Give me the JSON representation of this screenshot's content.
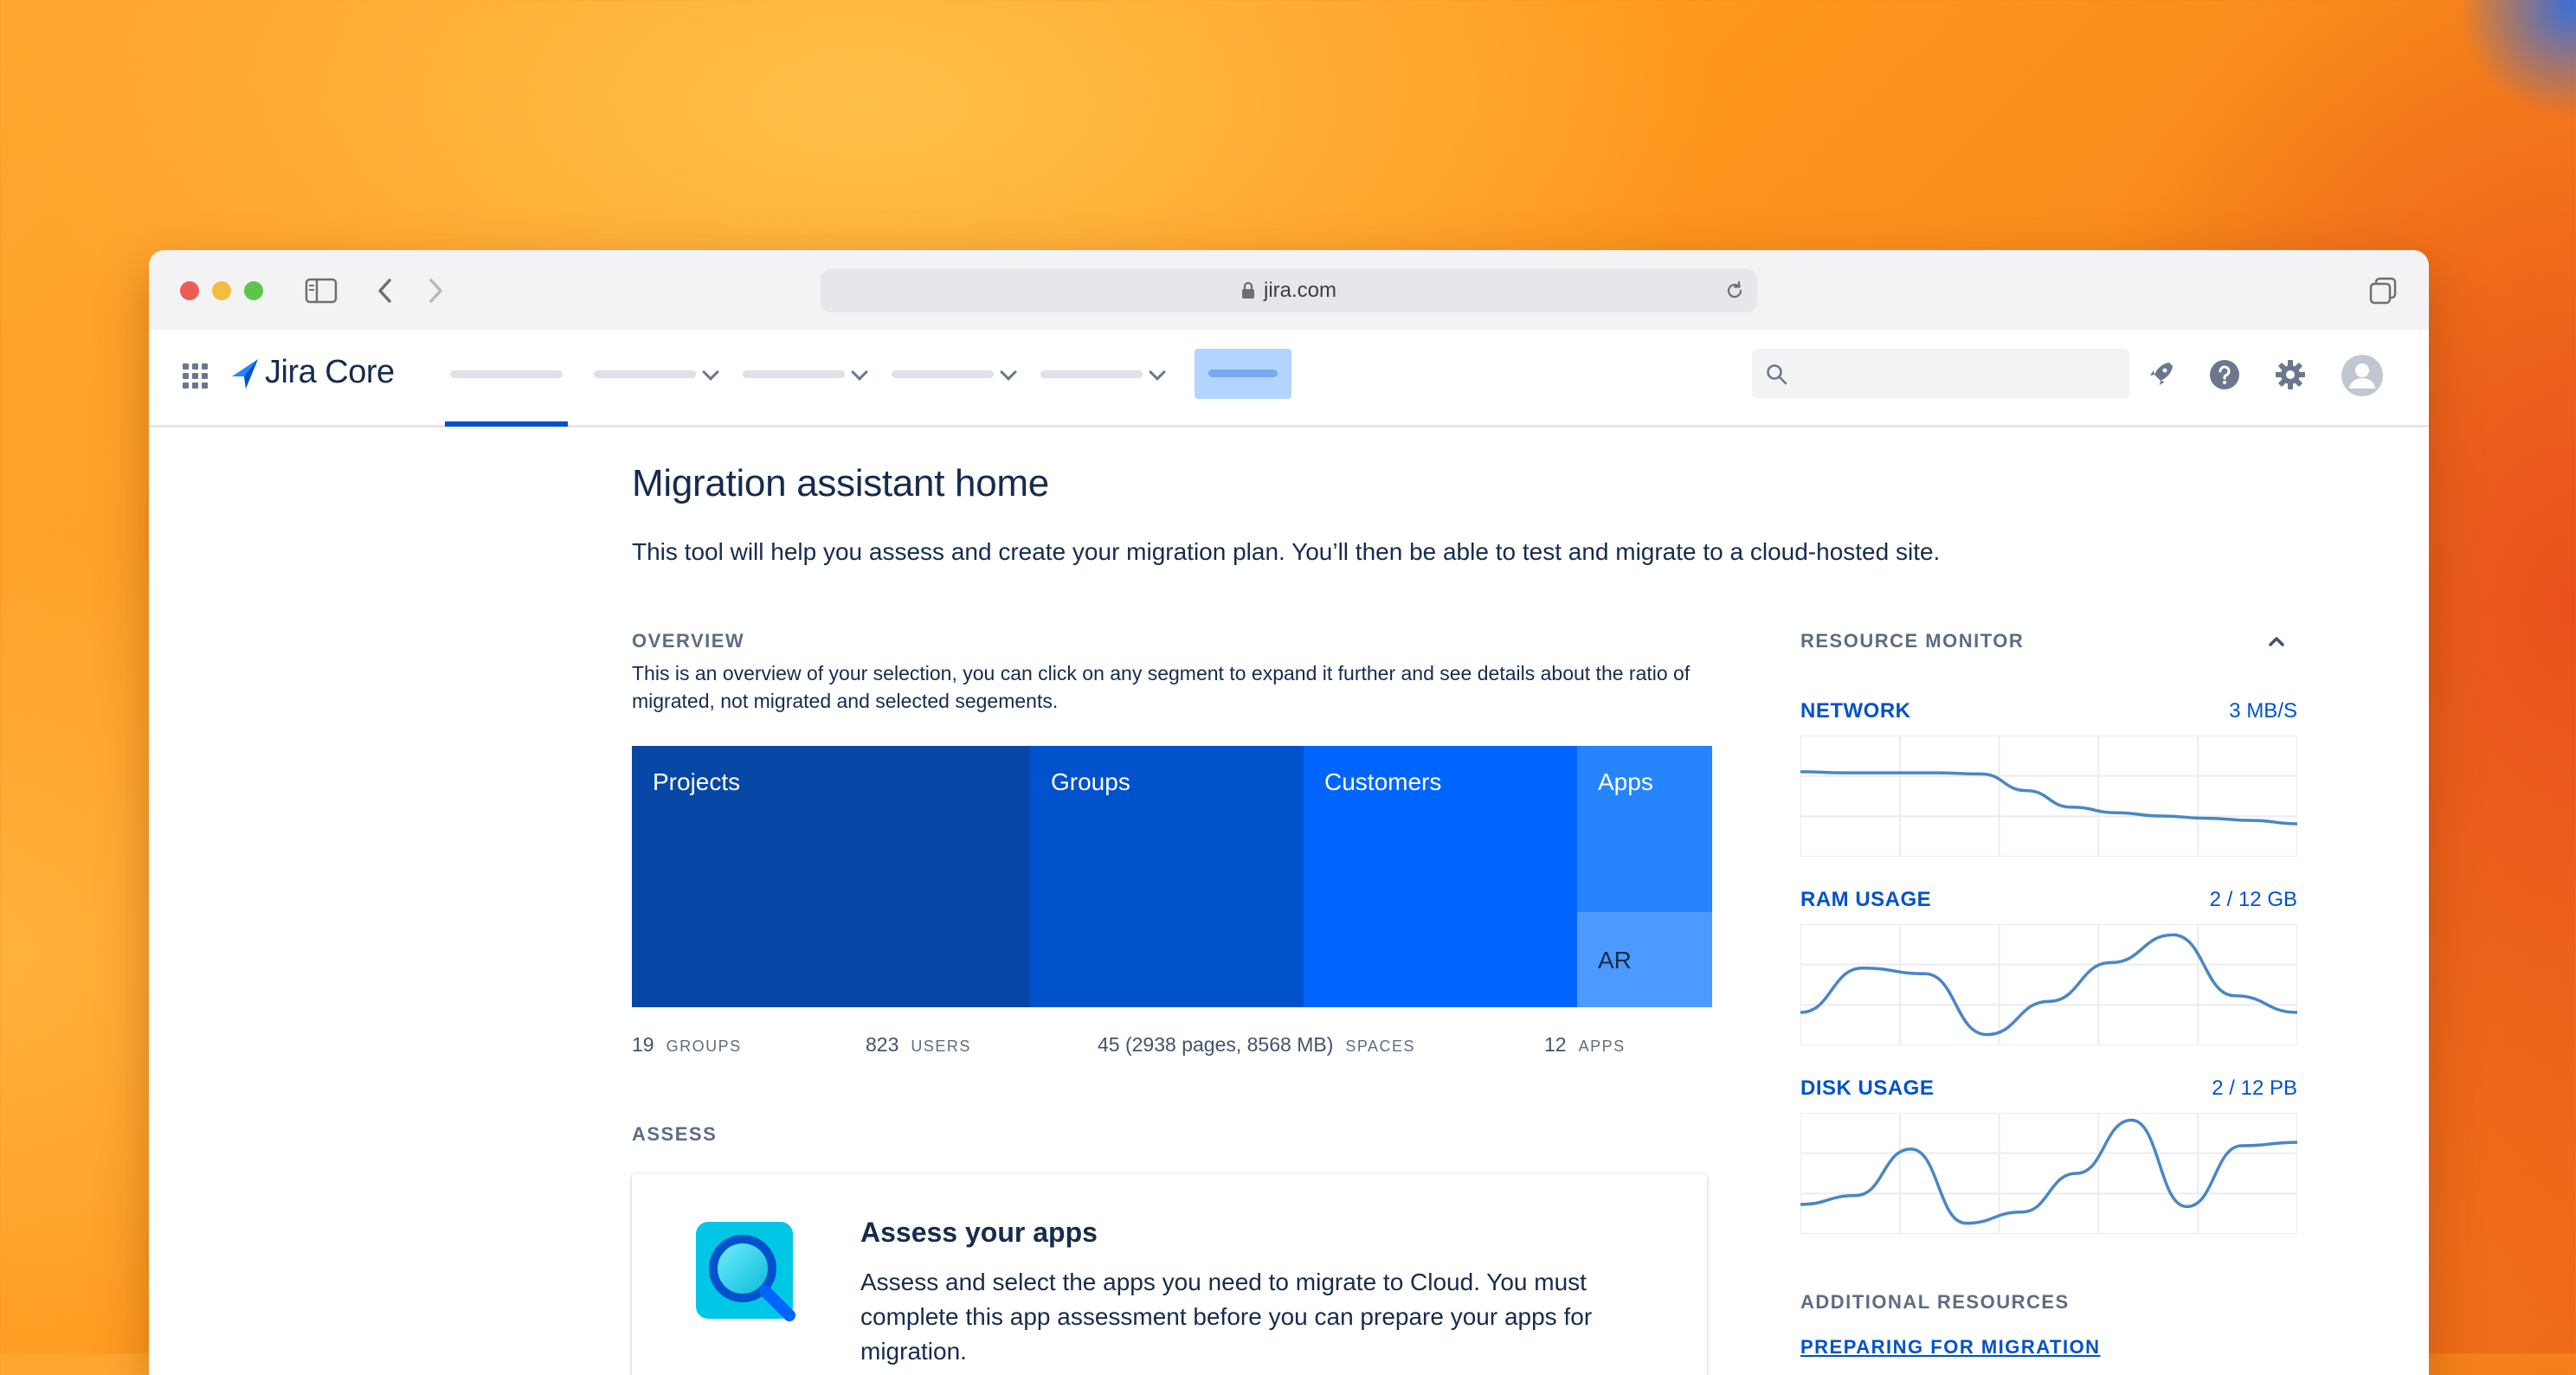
{
  "browser": {
    "url": "jira.com",
    "traffic_lights": [
      "#ee5c55",
      "#f5bd3e",
      "#5ec54b"
    ]
  },
  "app": {
    "name": "Jira Core",
    "brand_color": "#2684ff"
  },
  "page": {
    "title": "Migration assistant home",
    "intro": "This tool will help you assess and create your migration plan. You’ll then be able to test and migrate to a cloud-hosted site."
  },
  "overview": {
    "label": "OVERVIEW",
    "description": "This is an overview of your selection, you can click on any segment to expand it further and see details about the ratio of migrated, not migrated and selected segements.",
    "segments": [
      {
        "label": "Projects",
        "color": "#0747a6"
      },
      {
        "label": "Groups",
        "color": "#0052cc"
      },
      {
        "label": "Customers",
        "color": "#0065ff"
      },
      {
        "label": "Apps",
        "color": "#2684ff"
      },
      {
        "label": "AR",
        "color": "#4c9aff"
      }
    ],
    "stats": [
      {
        "value": "19",
        "caption": "GROUPS"
      },
      {
        "value": "823",
        "caption": "USERS"
      },
      {
        "value": "45 (2938 pages, 8568 MB)",
        "caption": "SPACES"
      },
      {
        "value": "12",
        "caption": "APPS"
      }
    ]
  },
  "assess": {
    "label": "ASSESS",
    "card_title": "Assess your apps",
    "card_description": "Assess and select the apps you need to migrate to Cloud. You must complete this app assessment before you can prepare your apps for migration."
  },
  "resource_monitor": {
    "label": "RESOURCE MONITOR",
    "line_color": "#4a86c5",
    "items": [
      {
        "name": "NETWORK",
        "value": "3 MB/S",
        "series": [
          0.72,
          0.71,
          0.71,
          0.71,
          0.7,
          0.55,
          0.4,
          0.35,
          0.32,
          0.3,
          0.28,
          0.25
        ]
      },
      {
        "name": "RAM USAGE",
        "value": "2 / 12 GB",
        "series": [
          0.25,
          0.65,
          0.6,
          0.05,
          0.35,
          0.7,
          0.95,
          0.4,
          0.25
        ]
      },
      {
        "name": "DISK USAGE",
        "value": "2 / 12 PB",
        "series": [
          0.22,
          0.3,
          0.72,
          0.05,
          0.15,
          0.5,
          0.98,
          0.2,
          0.75,
          0.78
        ]
      }
    ],
    "additional_label": "ADDITIONAL RESOURCES",
    "additional_link": "PREPARING FOR MIGRATION"
  }
}
